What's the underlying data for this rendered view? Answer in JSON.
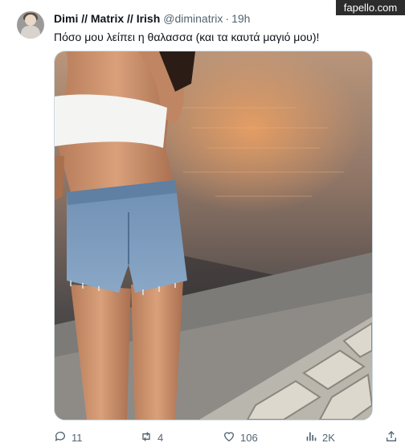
{
  "tweet": {
    "display_name": "Dimi // Matrix // Irish",
    "handle": "@diminatrix",
    "separator": "·",
    "time": "19h",
    "text": "Πόσο μου λείπει η θαλασσα (και τα καυτά μαγιό μου)!"
  },
  "actions": {
    "replies": "11",
    "retweets": "4",
    "likes": "106",
    "views": "2K"
  },
  "watermark": "fapello.com",
  "icons": {
    "reply": "speech-bubble-icon",
    "retweet": "retweet-arrows-icon",
    "like": "heart-icon",
    "views": "bar-chart-icon",
    "share": "share-upload-icon"
  },
  "colors": {
    "text": "#0f1419",
    "secondary": "#536471",
    "watermark_bg": "#2c2c2c"
  }
}
